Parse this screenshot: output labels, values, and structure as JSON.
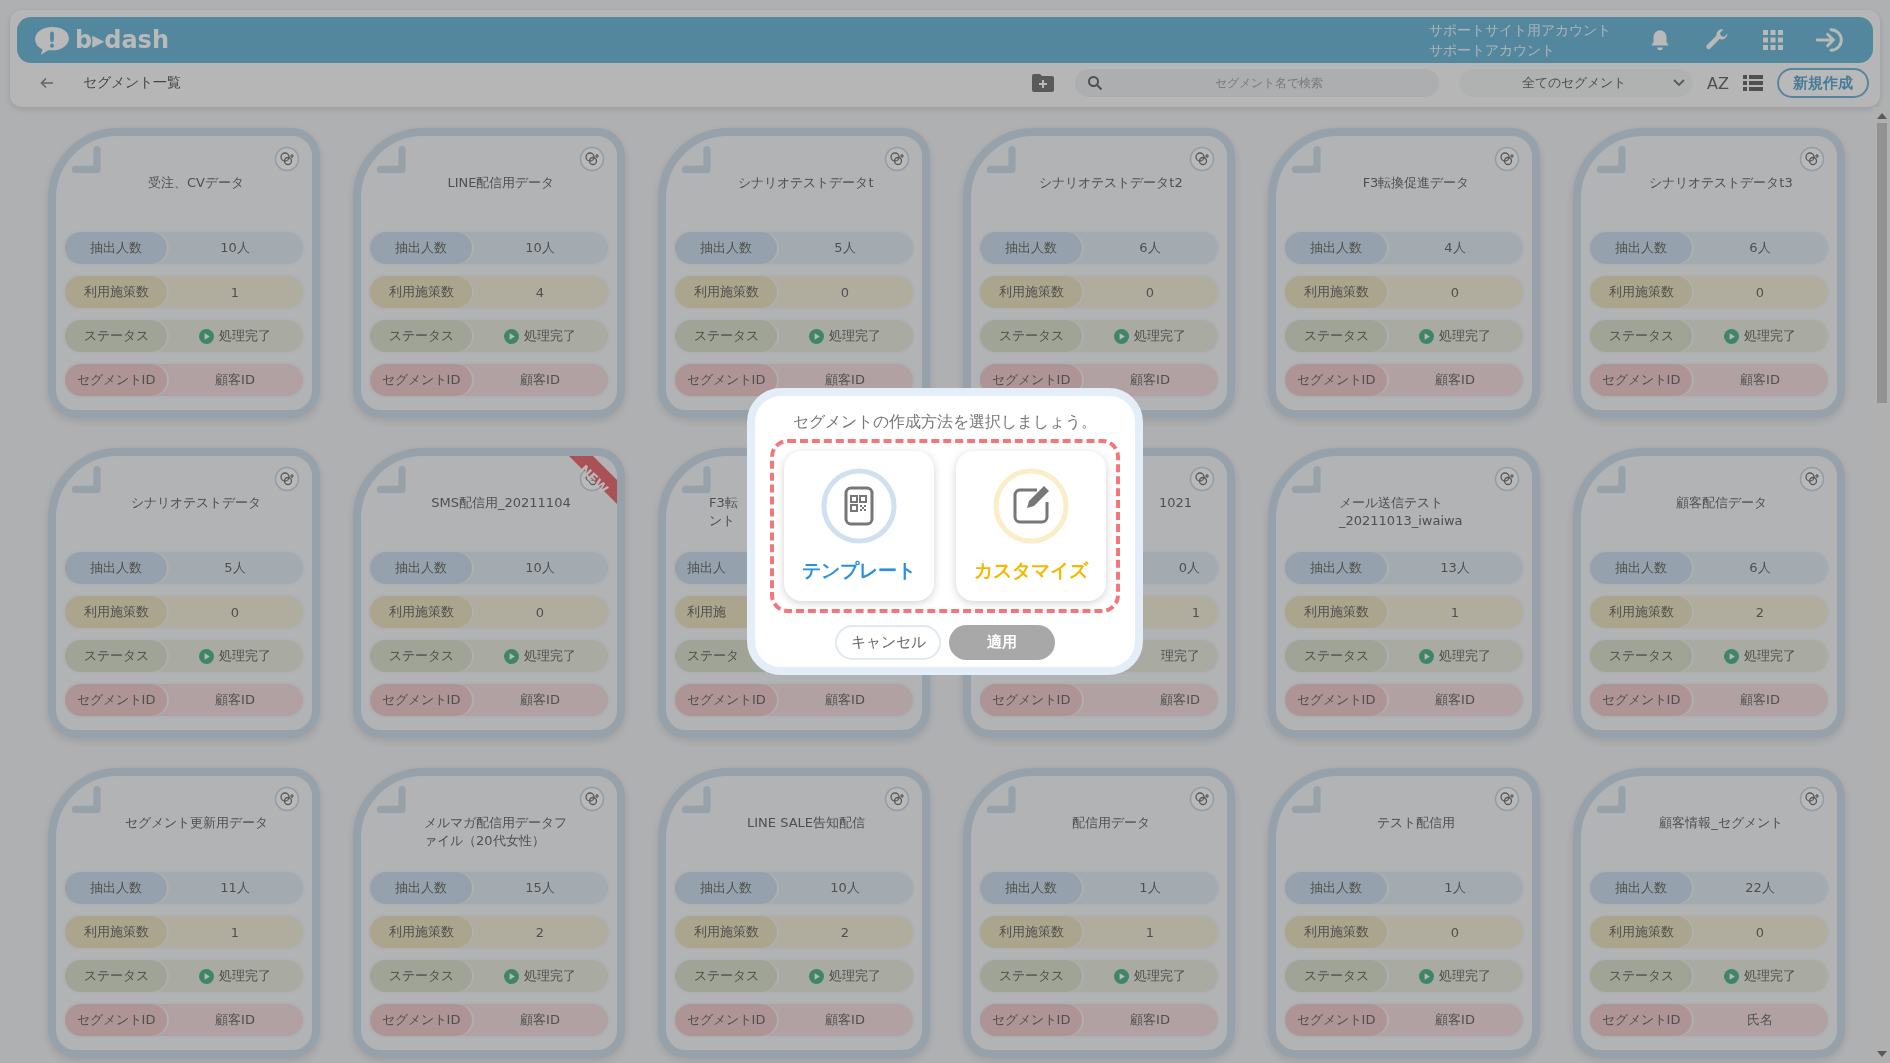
{
  "header": {
    "logo": "b▸dash",
    "account_lines": [
      "サポートサイト用アカウント",
      "サポートアカウント"
    ]
  },
  "toolbar": {
    "title": "セグメント一覧",
    "search": {
      "placeholder": "セグメント名で検索"
    },
    "filter": "全てのセグメント",
    "sort_label": "AZ",
    "new_button": "新規作成"
  },
  "cards": [
    {
      "kind": "full",
      "title": "受注、CVデータ",
      "rows": [
        {
          "kind": "count",
          "label": "抽出人数",
          "value": "10人"
        },
        {
          "kind": "usage",
          "label": "利用施策数",
          "value": "1"
        },
        {
          "kind": "status",
          "label": "ステータス",
          "value": "処理完了"
        },
        {
          "kind": "segment-id",
          "label": "セグメントID",
          "value": "顧客ID"
        }
      ]
    },
    {
      "kind": "full",
      "title": "LINE配信用データ",
      "rows": [
        {
          "kind": "count",
          "label": "抽出人数",
          "value": "10人"
        },
        {
          "kind": "usage",
          "label": "利用施策数",
          "value": "4"
        },
        {
          "kind": "status",
          "label": "ステータス",
          "value": "処理完了"
        },
        {
          "kind": "segment-id",
          "label": "セグメントID",
          "value": "顧客ID"
        }
      ]
    },
    {
      "kind": "full",
      "title": "シナリオテストデータt",
      "rows": [
        {
          "kind": "count",
          "label": "抽出人数",
          "value": "5人"
        },
        {
          "kind": "usage",
          "label": "利用施策数",
          "value": "0"
        },
        {
          "kind": "status",
          "label": "ステータス",
          "value": "処理完了"
        },
        {
          "kind": "segment-id",
          "label": "セグメントID",
          "value": "顧客ID"
        }
      ]
    },
    {
      "kind": "full",
      "title": "シナリオテストデータt2",
      "rows": [
        {
          "kind": "count",
          "label": "抽出人数",
          "value": "6人"
        },
        {
          "kind": "usage",
          "label": "利用施策数",
          "value": "0"
        },
        {
          "kind": "status",
          "label": "ステータス",
          "value": "処理完了"
        },
        {
          "kind": "segment-id",
          "label": "セグメントID",
          "value": "顧客ID"
        }
      ]
    },
    {
      "kind": "full",
      "title": "F3転換促進データ",
      "rows": [
        {
          "kind": "count",
          "label": "抽出人数",
          "value": "4人"
        },
        {
          "kind": "usage",
          "label": "利用施策数",
          "value": "0"
        },
        {
          "kind": "status",
          "label": "ステータス",
          "value": "処理完了"
        },
        {
          "kind": "segment-id",
          "label": "セグメントID",
          "value": "顧客ID"
        }
      ]
    },
    {
      "kind": "full",
      "title": "シナリオテストデータt3",
      "rows": [
        {
          "kind": "count",
          "label": "抽出人数",
          "value": "6人"
        },
        {
          "kind": "usage",
          "label": "利用施策数",
          "value": "0"
        },
        {
          "kind": "status",
          "label": "ステータス",
          "value": "処理完了"
        },
        {
          "kind": "segment-id",
          "label": "セグメントID",
          "value": "顧客ID"
        }
      ]
    },
    {
      "kind": "full",
      "title": "シナリオテストデータ",
      "rows": [
        {
          "kind": "count",
          "label": "抽出人数",
          "value": "5人"
        },
        {
          "kind": "usage",
          "label": "利用施策数",
          "value": "0"
        },
        {
          "kind": "status",
          "label": "ステータス",
          "value": "処理完了"
        },
        {
          "kind": "segment-id",
          "label": "セグメントID",
          "value": "顧客ID"
        }
      ]
    },
    {
      "kind": "full",
      "title": "SMS配信用_20211104",
      "badge": "NEW",
      "rows": [
        {
          "kind": "count",
          "label": "抽出人数",
          "value": "10人"
        },
        {
          "kind": "usage",
          "label": "利用施策数",
          "value": "0"
        },
        {
          "kind": "status",
          "label": "ステータス",
          "value": "処理完了"
        },
        {
          "kind": "segment-id",
          "label": "セグメントID",
          "value": "顧客ID"
        }
      ]
    },
    {
      "kind": "left-part",
      "title": [
        "F3転",
        "ント"
      ],
      "rows": [
        {
          "kind": "count",
          "label": "抽出人"
        },
        {
          "kind": "usage",
          "label": "利用施"
        },
        {
          "kind": "status",
          "label": "ステータ"
        },
        {
          "kind": "segment-id",
          "label": "セグメントID",
          "value": "顧客ID"
        }
      ]
    },
    {
      "kind": "right-part",
      "title": "1021",
      "rows": [
        {
          "kind": "count",
          "value": "0人"
        },
        {
          "kind": "usage",
          "value": "1"
        },
        {
          "kind": "status",
          "value": "理完了"
        },
        {
          "kind": "segment-id",
          "label": "セグメントID",
          "value": "顧客ID"
        }
      ]
    },
    {
      "kind": "full",
      "title": "メール送信テスト_20211013_iwaiwa",
      "rows": [
        {
          "kind": "count",
          "label": "抽出人数",
          "value": "13人"
        },
        {
          "kind": "usage",
          "label": "利用施策数",
          "value": "1"
        },
        {
          "kind": "status",
          "label": "ステータス",
          "value": "処理完了"
        },
        {
          "kind": "segment-id",
          "label": "セグメントID",
          "value": "顧客ID"
        }
      ]
    },
    {
      "kind": "full",
      "title": "顧客配信データ",
      "rows": [
        {
          "kind": "count",
          "label": "抽出人数",
          "value": "6人"
        },
        {
          "kind": "usage",
          "label": "利用施策数",
          "value": "2"
        },
        {
          "kind": "status",
          "label": "ステータス",
          "value": "処理完了"
        },
        {
          "kind": "segment-id",
          "label": "セグメントID",
          "value": "顧客ID"
        }
      ]
    },
    {
      "kind": "full",
      "title": "セグメント更新用データ",
      "rows": [
        {
          "kind": "count",
          "label": "抽出人数",
          "value": "11人"
        },
        {
          "kind": "usage",
          "label": "利用施策数",
          "value": "1"
        },
        {
          "kind": "status",
          "label": "ステータス",
          "value": "処理完了"
        },
        {
          "kind": "segment-id",
          "label": "セグメントID",
          "value": "顧客ID"
        }
      ]
    },
    {
      "kind": "full",
      "title": "メルマガ配信用データファイル（20代女性）",
      "rows": [
        {
          "kind": "count",
          "label": "抽出人数",
          "value": "15人"
        },
        {
          "kind": "usage",
          "label": "利用施策数",
          "value": "2"
        },
        {
          "kind": "status",
          "label": "ステータス",
          "value": "処理完了"
        },
        {
          "kind": "segment-id",
          "label": "セグメントID",
          "value": "顧客ID"
        }
      ]
    },
    {
      "kind": "full",
      "title": "LINE SALE告知配信",
      "rows": [
        {
          "kind": "count",
          "label": "抽出人数",
          "value": "10人"
        },
        {
          "kind": "usage",
          "label": "利用施策数",
          "value": "2"
        },
        {
          "kind": "status",
          "label": "ステータス",
          "value": "処理完了"
        },
        {
          "kind": "segment-id",
          "label": "セグメントID",
          "value": "顧客ID"
        }
      ]
    },
    {
      "kind": "full",
      "title": "配信用データ",
      "rows": [
        {
          "kind": "count",
          "label": "抽出人数",
          "value": "1人"
        },
        {
          "kind": "usage",
          "label": "利用施策数",
          "value": "1"
        },
        {
          "kind": "status",
          "label": "ステータス",
          "value": "処理完了"
        },
        {
          "kind": "segment-id",
          "label": "セグメントID",
          "value": "顧客ID"
        }
      ]
    },
    {
      "kind": "full",
      "title": "テスト配信用",
      "rows": [
        {
          "kind": "count",
          "label": "抽出人数",
          "value": "1人"
        },
        {
          "kind": "usage",
          "label": "利用施策数",
          "value": "0"
        },
        {
          "kind": "status",
          "label": "ステータス",
          "value": "処理完了"
        },
        {
          "kind": "segment-id",
          "label": "セグメントID",
          "value": "顧客ID"
        }
      ]
    },
    {
      "kind": "full",
      "title": "顧客情報_セグメント",
      "rows": [
        {
          "kind": "count",
          "label": "抽出人数",
          "value": "22人"
        },
        {
          "kind": "usage",
          "label": "利用施策数",
          "value": "0"
        },
        {
          "kind": "status",
          "label": "ステータス",
          "value": "処理完了"
        },
        {
          "kind": "segment-id",
          "label": "セグメントID",
          "value": "氏名"
        }
      ]
    }
  ],
  "dialog": {
    "prompt": "セグメントの作成方法を選択しましょう。",
    "options": [
      {
        "kind": "template",
        "label": "テンプレート"
      },
      {
        "kind": "customize",
        "label": "カスタマイズ"
      }
    ],
    "buttons": [
      {
        "label": "キャンセル",
        "disabled": false
      },
      {
        "label": "適用",
        "disabled": true
      }
    ]
  }
}
